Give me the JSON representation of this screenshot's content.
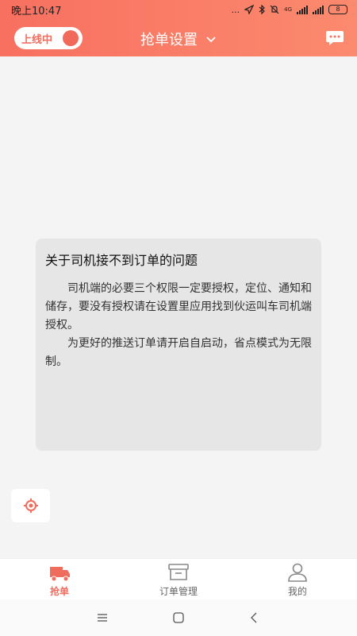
{
  "status_bar": {
    "time": "晚上10:47",
    "dots": "...",
    "network": "4G",
    "battery": "8"
  },
  "header": {
    "online_toggle_label": "上线中",
    "title": "抢单设置",
    "title_icon": "chevron-down-icon",
    "message_icon": "chat-bubble-icon"
  },
  "notice": {
    "title": "关于司机接不到订单的问题",
    "paragraphs": [
      "司机端的必要三个权限一定要授权，定位、通知和储存，要没有授权请在设置里应用找到伙运叫车司机端授权。",
      "为更好的推送订单请开启自启动，省点模式为无限制。"
    ]
  },
  "locate_button": {
    "icon": "locate-target-icon"
  },
  "tabs": [
    {
      "label": "抢单",
      "icon": "truck-icon",
      "active": true
    },
    {
      "label": "订单管理",
      "icon": "box-icon",
      "active": false
    },
    {
      "label": "我的",
      "icon": "person-icon",
      "active": false
    }
  ],
  "colors": {
    "accent": "#f06c5d",
    "header_gradient_start": "#f87060",
    "header_gradient_end": "#fb8a6e",
    "background": "#f4f4f4",
    "notice_bg": "#e6e6e6"
  }
}
